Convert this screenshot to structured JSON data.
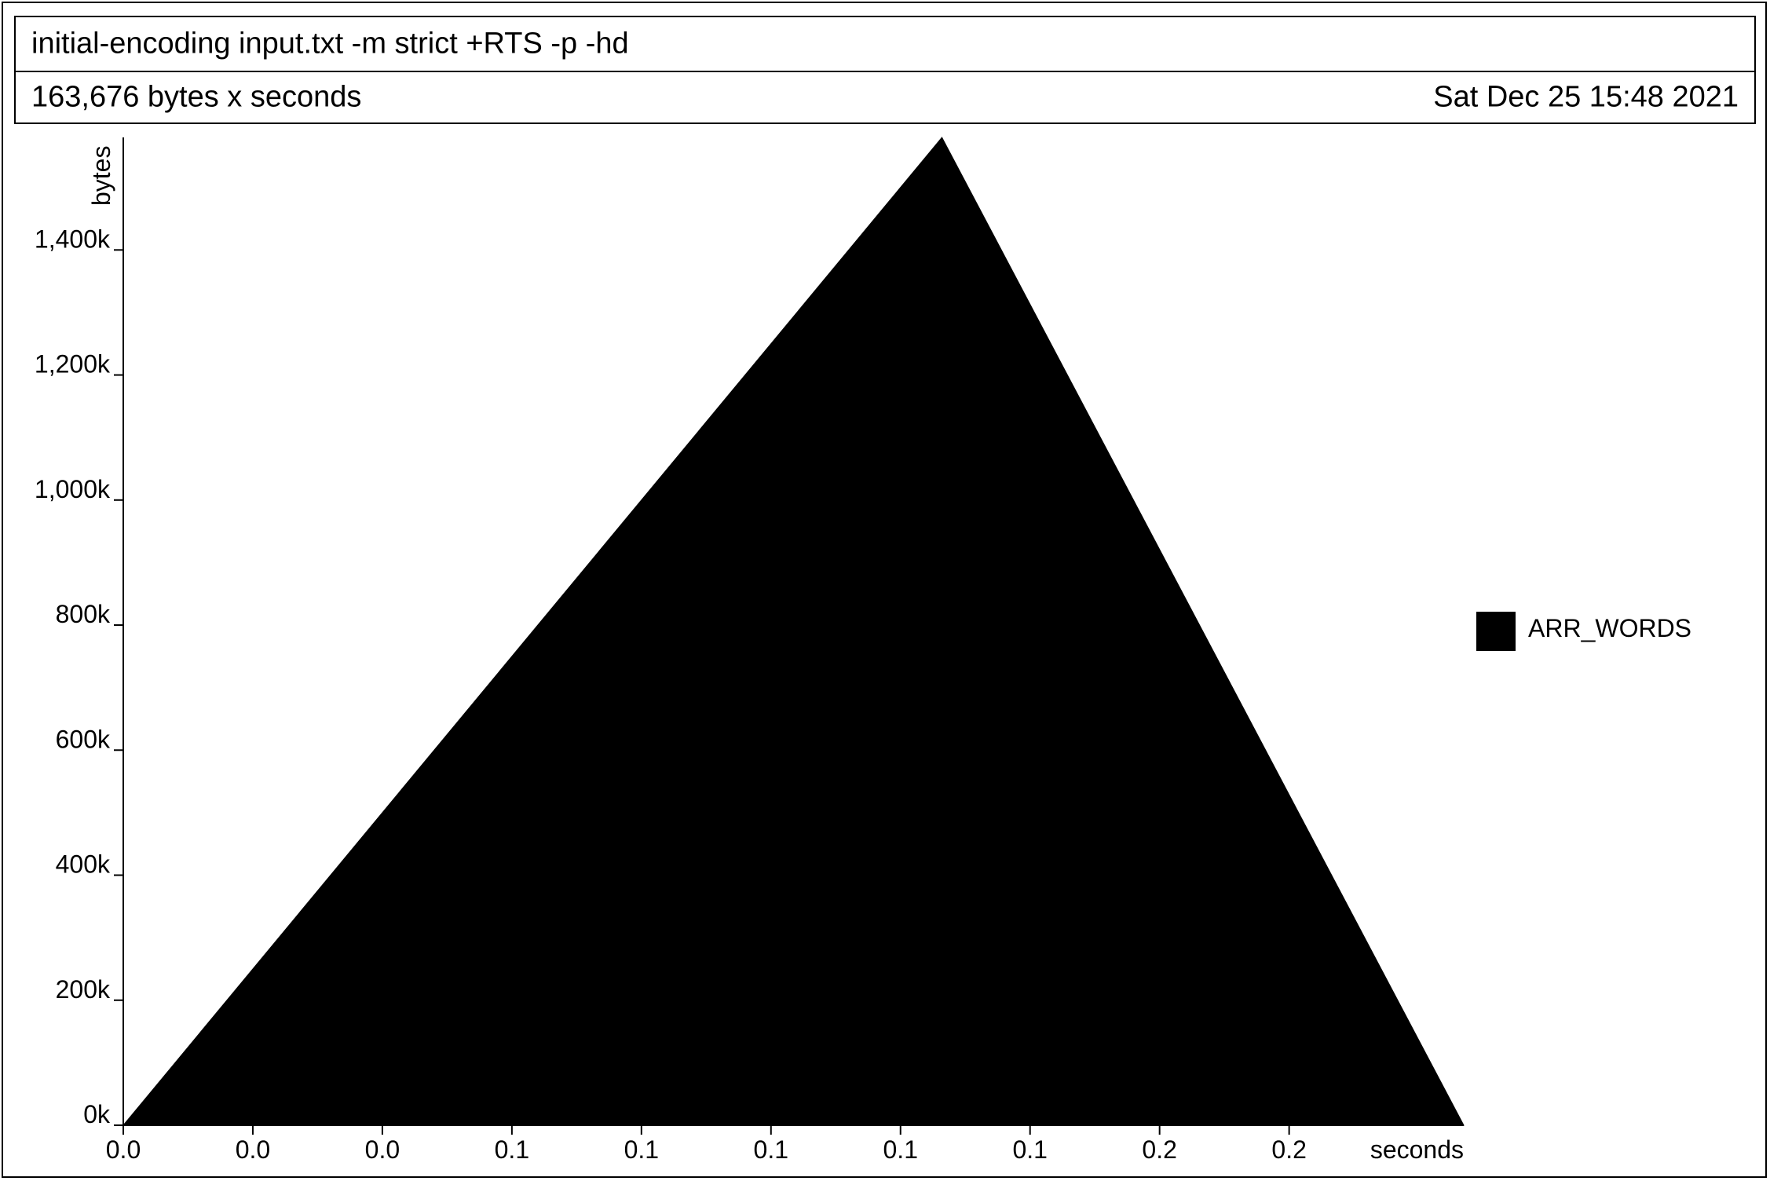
{
  "header": {
    "title": "initial-encoding input.txt -m strict +RTS -p -hd",
    "total": "163,676 bytes x seconds",
    "date": "Sat Dec 25 15:48 2021"
  },
  "chart_data": {
    "type": "area",
    "title": "initial-encoding input.txt -m strict +RTS -p -hd",
    "subtitle": "163,676 bytes x seconds",
    "xlabel": "seconds",
    "ylabel": "bytes",
    "xlim": [
      0,
      0.2587
    ],
    "ylim": [
      0,
      1580000
    ],
    "x_ticks": [
      0,
      0.025,
      0.05,
      0.075,
      0.1,
      0.125,
      0.15,
      0.175,
      0.2,
      0.225
    ],
    "x_tick_labels": [
      "0.0",
      "0.0",
      "0.0",
      "0.1",
      "0.1",
      "0.1",
      "0.1",
      "0.1",
      "0.2",
      "0.2"
    ],
    "y_ticks": [
      0,
      200000,
      400000,
      600000,
      800000,
      1000000,
      1200000,
      1400000
    ],
    "y_tick_labels": [
      "0k",
      "200k",
      "400k",
      "600k",
      "800k",
      "1,000k",
      "1,200k",
      "1,400k"
    ],
    "grid": false,
    "legend_position": "right",
    "series": [
      {
        "name": "ARR_WORDS",
        "color": "#000000",
        "x": [
          0,
          0.158,
          0.2587
        ],
        "y": [
          0,
          1580000,
          0
        ]
      }
    ]
  }
}
